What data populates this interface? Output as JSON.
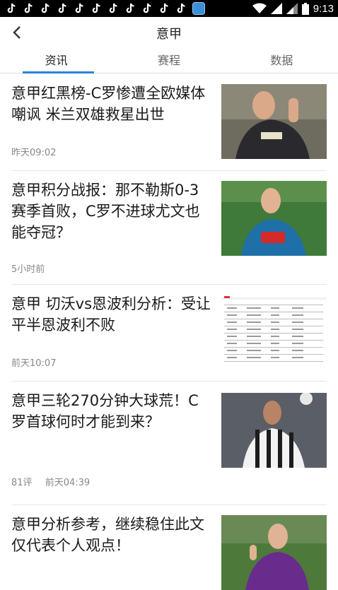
{
  "status_bar": {
    "time": "9:13",
    "notification_icons": [
      "tiktok-icon",
      "tiktok-icon",
      "tiktok-icon",
      "tiktok-icon",
      "tiktok-icon",
      "tiktok-icon",
      "tiktok-icon",
      "tiktok-icon",
      "tiktok-icon",
      "tiktok-icon",
      "tiktok-icon",
      "app-icon"
    ]
  },
  "header": {
    "title": "意甲",
    "back_icon": "chevron-left-icon"
  },
  "tabs": [
    {
      "label": "资讯",
      "active": true
    },
    {
      "label": "赛程",
      "active": false
    },
    {
      "label": "数据",
      "active": false
    }
  ],
  "news": [
    {
      "title": "意甲红黑榜-C罗惨遭全欧媒体嘲讽 米兰双雄救星出世",
      "time": "昨天09:02",
      "comments": ""
    },
    {
      "title": "意甲积分战报：那不勒斯0-3赛季首败，C罗不进球尤文也能夺冠？",
      "time": "5小时前",
      "comments": ""
    },
    {
      "title": "意甲 切沃vs恩波利分析：受让平半恩波利不败",
      "time": "前天10:07",
      "comments": ""
    },
    {
      "title": "意甲三轮270分钟大球荒！C罗首球何时才能到来？",
      "time": "前天04:39",
      "comments": "81评"
    },
    {
      "title": "意甲分析参考，继续稳住此文仅代表个人观点！",
      "time": "",
      "comments": ""
    }
  ],
  "colors": {
    "accent": "#2a86d8",
    "status_bar": "#000000"
  }
}
